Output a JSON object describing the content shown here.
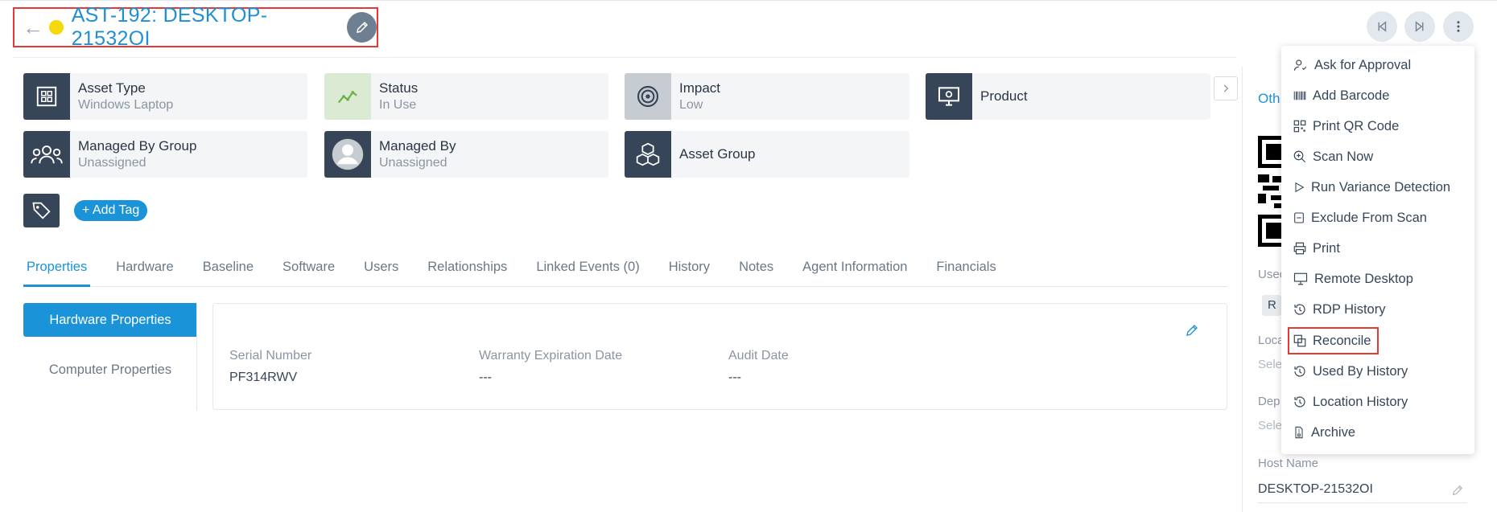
{
  "header": {
    "title": "AST-192: DESKTOP-21532OI",
    "back_icon": "←",
    "status_color": "#f5d90a"
  },
  "cards": [
    {
      "label": "Asset Type",
      "value": "Windows Laptop",
      "icon": "windows-icon"
    },
    {
      "label": "Status",
      "value": "In Use",
      "icon": "trend-line-icon"
    },
    {
      "label": "Impact",
      "value": "Low",
      "icon": "target-icon"
    },
    {
      "label": "Product",
      "value": "",
      "icon": "monitor-gear-icon"
    },
    {
      "label": "Managed By Group",
      "value": "Unassigned",
      "icon": "group-icon"
    },
    {
      "label": "Managed By",
      "value": "Unassigned",
      "icon": "user-avatar-icon"
    },
    {
      "label": "Asset Group",
      "value": "",
      "icon": "cubes-icon"
    }
  ],
  "tags": {
    "add_label": "+ Add Tag"
  },
  "tabs": [
    {
      "label": "Properties"
    },
    {
      "label": "Hardware"
    },
    {
      "label": "Baseline"
    },
    {
      "label": "Software"
    },
    {
      "label": "Users"
    },
    {
      "label": "Relationships"
    },
    {
      "label": "Linked Events (0)"
    },
    {
      "label": "History"
    },
    {
      "label": "Notes"
    },
    {
      "label": "Agent Information"
    },
    {
      "label": "Financials"
    }
  ],
  "side_nav": [
    {
      "label": "Hardware Properties"
    },
    {
      "label": "Computer Properties"
    }
  ],
  "properties": [
    {
      "label": "Serial Number",
      "value": "PF314RWV"
    },
    {
      "label": "Warranty Expiration Date",
      "value": "---"
    },
    {
      "label": "Audit Date",
      "value": "---"
    }
  ],
  "right_panel": {
    "section": "Oth",
    "used": "Usec",
    "chip": "R",
    "loc": "Loca",
    "loc_val": "Sele",
    "dep": "Dep",
    "dep_val": "Sele",
    "host_label": "Host Name",
    "host_value": "DESKTOP-21532OI"
  },
  "menu": [
    {
      "label": "Ask for Approval",
      "icon": "user-check-icon"
    },
    {
      "label": "Add Barcode",
      "icon": "barcode-icon"
    },
    {
      "label": "Print QR Code",
      "icon": "qr-code-icon"
    },
    {
      "label": "Scan Now",
      "icon": "scan-search-icon"
    },
    {
      "label": "Run Variance Detection",
      "icon": "play-icon"
    },
    {
      "label": "Exclude From Scan",
      "icon": "minus-square-icon"
    },
    {
      "label": "Print",
      "icon": "printer-icon"
    },
    {
      "label": "Remote Desktop",
      "icon": "monitor-icon"
    },
    {
      "label": "RDP History",
      "icon": "history-icon"
    },
    {
      "label": "Reconcile",
      "icon": "reconcile-icon"
    },
    {
      "label": "Used By History",
      "icon": "history-icon"
    },
    {
      "label": "Location History",
      "icon": "history-icon"
    },
    {
      "label": "Archive",
      "icon": "archive-icon"
    }
  ],
  "colors": {
    "accent": "#1a93d8",
    "dark": "#364658",
    "highlight": "#e53935"
  }
}
